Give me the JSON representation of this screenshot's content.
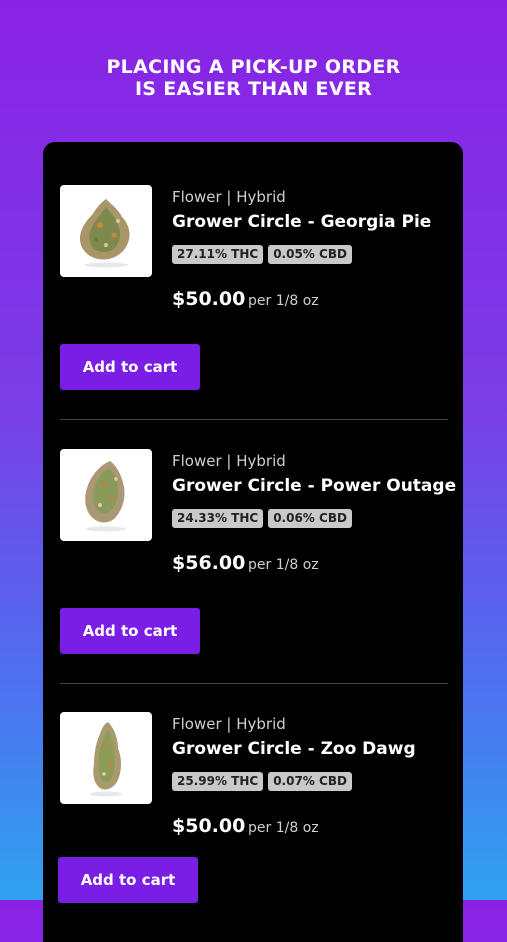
{
  "headline": {
    "line1": "PLACING A PICK-UP ORDER",
    "line2": "IS EASIER THAN EVER"
  },
  "products": [
    {
      "category": "Flower | Hybrid",
      "name": "Grower Circle - Georgia Pie",
      "thc": "27.11% THC",
      "cbd": "0.05% CBD",
      "price": "$50.00",
      "unit": "per 1/8 oz",
      "cart_label": "Add to cart"
    },
    {
      "category": "Flower | Hybrid",
      "name": "Grower Circle - Power Outage",
      "thc": "24.33% THC",
      "cbd": "0.06% CBD",
      "price": "$56.00",
      "unit": "per 1/8 oz",
      "cart_label": "Add to cart"
    },
    {
      "category": "Flower | Hybrid",
      "name": "Grower Circle - Zoo Dawg",
      "thc": "25.99% THC",
      "cbd": "0.07% CBD",
      "price": "$50.00",
      "unit": "per 1/8 oz",
      "cart_label": "Add to cart"
    }
  ],
  "colors": {
    "accent": "#7a1ee6",
    "card_background": "#000000",
    "badge_background": "#c9c9c9"
  }
}
